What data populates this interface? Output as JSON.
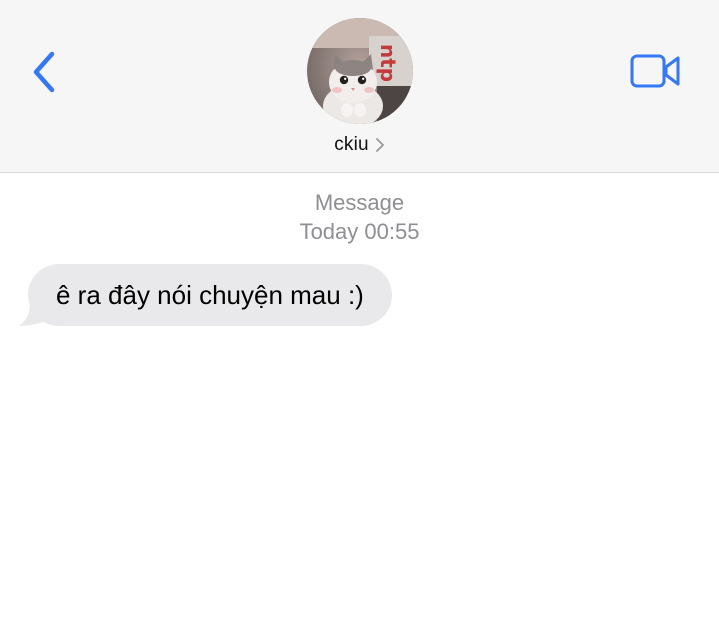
{
  "header": {
    "contact_name": "ckiu",
    "back_icon": "chevron-left-icon",
    "video_icon": "video-camera-icon",
    "accent_color": "#3478f6",
    "avatar_icon": "kitten-photo"
  },
  "thread": {
    "service_label": "Message",
    "timestamp": "Today 00:55",
    "messages": [
      {
        "direction": "incoming",
        "text": "ê ra đây nói chuyện mau :)"
      }
    ]
  }
}
